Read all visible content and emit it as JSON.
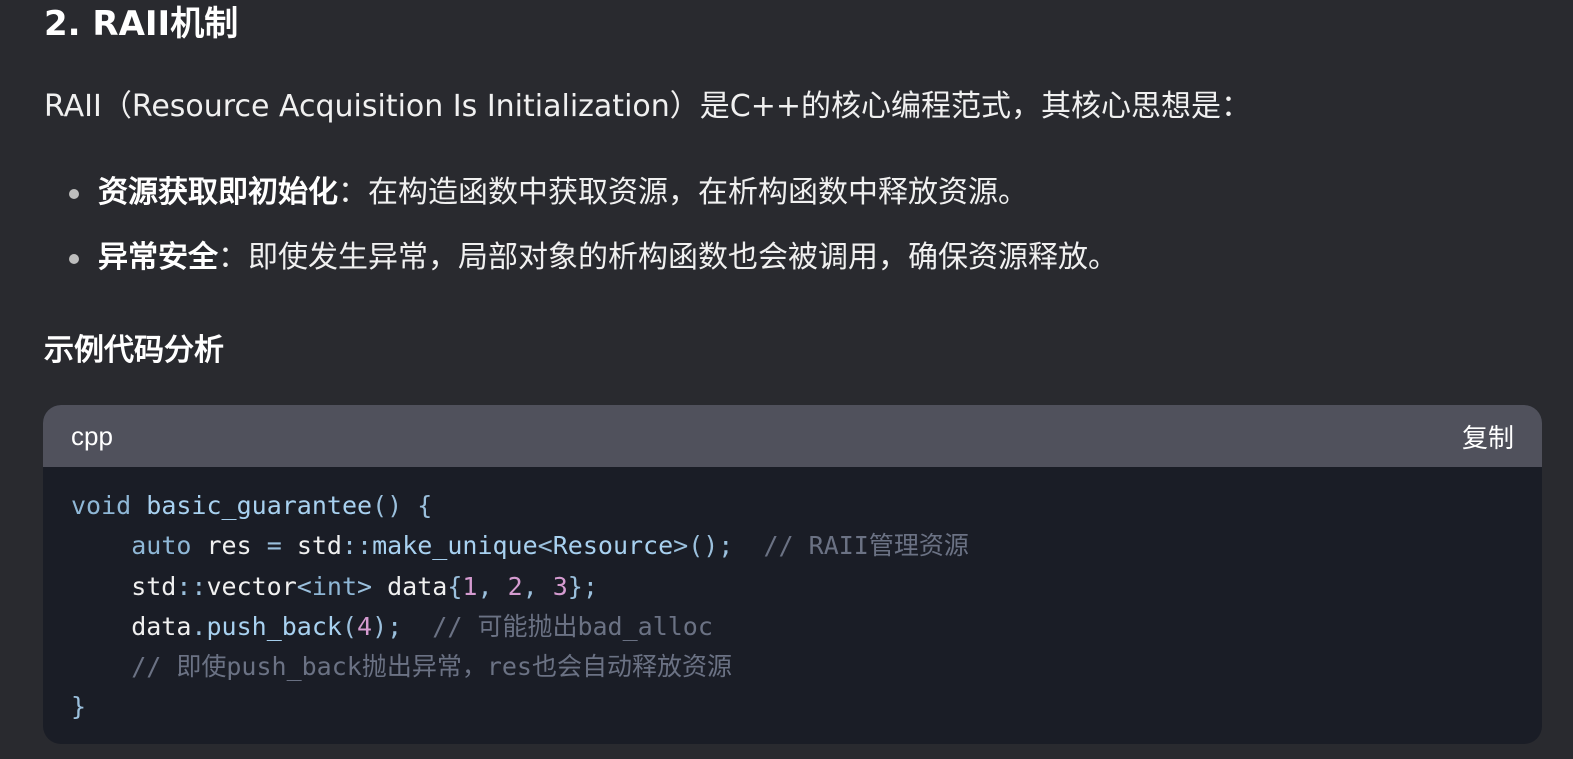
{
  "section_title": "2. RAII机制",
  "intro_text": "RAII（Resource Acquisition Is Initialization）是C++的核心编程范式，其核心思想是：",
  "bullets": [
    {
      "term": "资源获取即初始化",
      "text": "：在构造函数中获取资源，在析构函数中释放资源。"
    },
    {
      "term": "异常安全",
      "text": "：即使发生异常，局部对象的析构函数也会被调用，确保资源释放。"
    }
  ],
  "subsection_title": "示例代码分析",
  "code": {
    "language": "cpp",
    "copy_label": "复制",
    "lines": [
      [
        [
          "kw",
          "void"
        ],
        [
          "id",
          " "
        ],
        [
          "fn",
          "basic_guarantee"
        ],
        [
          "punc",
          "() {"
        ]
      ],
      [
        [
          "id",
          "    "
        ],
        [
          "kw",
          "auto"
        ],
        [
          "id",
          " res "
        ],
        [
          "op",
          "="
        ],
        [
          "id",
          " std"
        ],
        [
          "op",
          "::"
        ],
        [
          "fn",
          "make_unique"
        ],
        [
          "punc",
          "<"
        ],
        [
          "ty",
          "Resource"
        ],
        [
          "punc",
          ">();"
        ],
        [
          "id",
          "  "
        ],
        [
          "cm",
          "// RAII管理资源"
        ]
      ],
      [
        [
          "id",
          "    std"
        ],
        [
          "op",
          "::"
        ],
        [
          "id",
          "vector"
        ],
        [
          "punc",
          "<"
        ],
        [
          "kw",
          "int"
        ],
        [
          "punc",
          ">"
        ],
        [
          "id",
          " data"
        ],
        [
          "punc",
          "{"
        ],
        [
          "num",
          "1"
        ],
        [
          "punc",
          ", "
        ],
        [
          "num",
          "2"
        ],
        [
          "punc",
          ", "
        ],
        [
          "num",
          "3"
        ],
        [
          "punc",
          "};"
        ]
      ],
      [
        [
          "id",
          "    data"
        ],
        [
          "punc",
          "."
        ],
        [
          "fn",
          "push_back"
        ],
        [
          "punc",
          "("
        ],
        [
          "num",
          "4"
        ],
        [
          "punc",
          ");"
        ],
        [
          "id",
          "  "
        ],
        [
          "cm",
          "// 可能抛出bad_alloc"
        ]
      ],
      [
        [
          "id",
          "    "
        ],
        [
          "cm",
          "// 即使push_back抛出异常，res也会自动释放资源"
        ]
      ],
      [
        [
          "punc",
          "}"
        ]
      ]
    ]
  },
  "colors": {
    "background": "#292a2f",
    "code_background": "#1a1d26",
    "code_header": "#50515c",
    "keyword": "#8fb7d6",
    "comment": "#6b7284",
    "number": "#d59bd0"
  }
}
